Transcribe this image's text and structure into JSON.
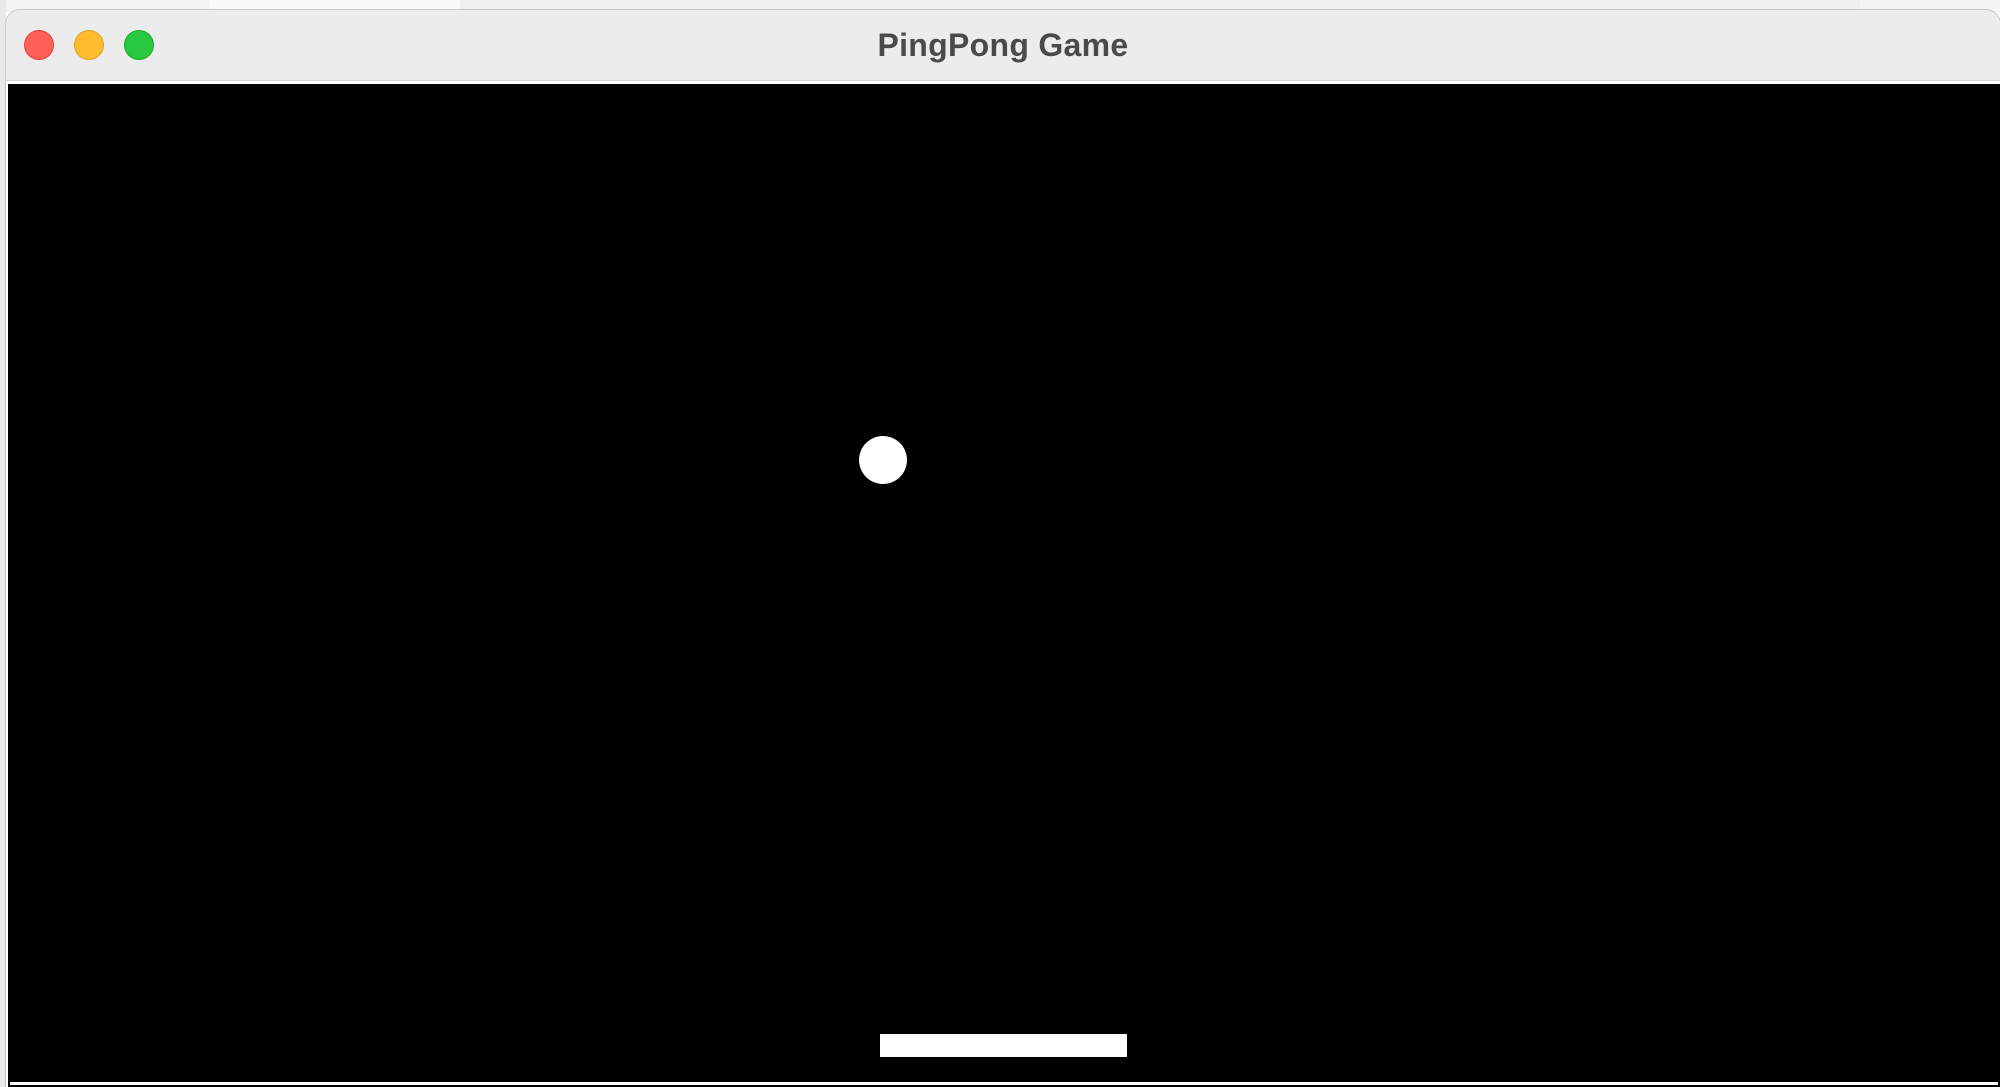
{
  "window": {
    "title": "PingPong Game",
    "controls": {
      "close": "close",
      "minimize": "minimize",
      "zoom": "zoom"
    }
  },
  "game": {
    "background_color": "#000000",
    "ball_color": "#ffffff",
    "paddle_color": "#ffffff"
  }
}
